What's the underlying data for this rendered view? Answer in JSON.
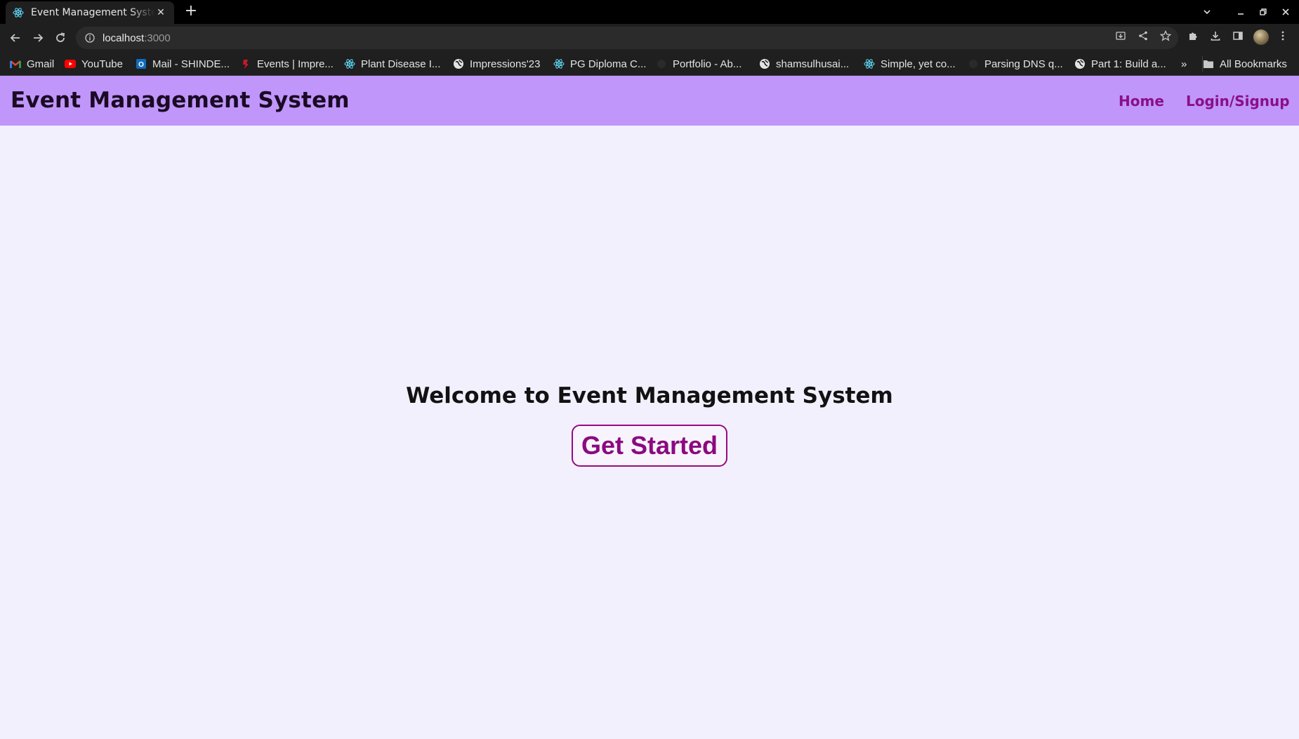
{
  "browser": {
    "tab": {
      "title": "Event Management System"
    },
    "address_bar": {
      "host": "localhost",
      "port": ":3000"
    },
    "bookmarks": [
      {
        "label": "Gmail",
        "icon": "gmail-icon"
      },
      {
        "label": "YouTube",
        "icon": "youtube-icon"
      },
      {
        "label": "Mail - SHINDE...",
        "icon": "outlook-icon"
      },
      {
        "label": "Events | Impre...",
        "icon": "events-icon"
      },
      {
        "label": "Plant Disease I...",
        "icon": "react-icon"
      },
      {
        "label": "Impressions'23",
        "icon": "globe-icon"
      },
      {
        "label": "PG Diploma C...",
        "icon": "react-icon"
      },
      {
        "label": "Portfolio - Ab...",
        "icon": "dark-favicon-icon"
      },
      {
        "label": "shamsulhusai...",
        "icon": "globe-icon"
      },
      {
        "label": "Simple, yet co...",
        "icon": "react-icon"
      },
      {
        "label": "Parsing DNS q...",
        "icon": "dark-favicon-icon"
      },
      {
        "label": "Part 1: Build a...",
        "icon": "globe-icon"
      }
    ],
    "overflow_label": "»",
    "all_bookmarks_label": "All Bookmarks"
  },
  "navbar": {
    "brand": "Event Management System",
    "links": [
      {
        "label": "Home"
      },
      {
        "label": "Login/Signup"
      }
    ]
  },
  "hero": {
    "title": "Welcome to Event Management System",
    "cta_label": "Get Started"
  },
  "colors": {
    "navbar_bg": "#c096fb",
    "page_bg": "#f3f0fe",
    "accent": "#8b0a7f"
  }
}
